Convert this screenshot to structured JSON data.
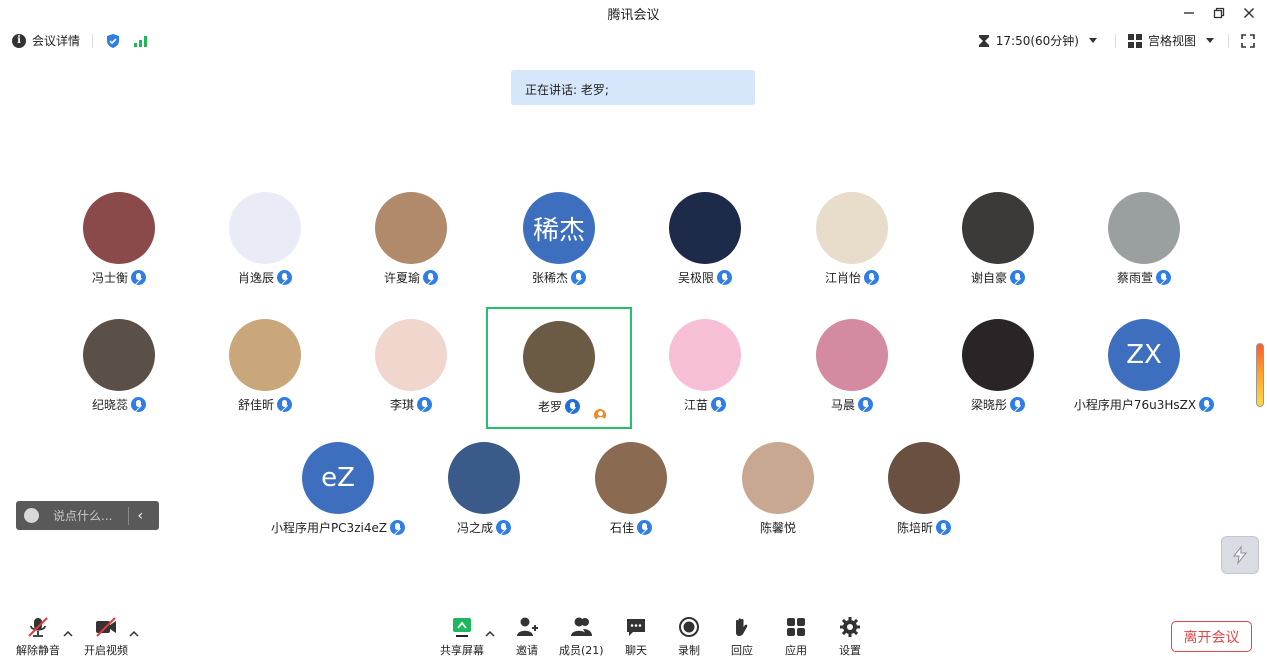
{
  "window": {
    "title": "腾讯会议"
  },
  "infobar": {
    "meeting_details": "会议详情",
    "time": "17:50(60分钟)",
    "view_mode": "宫格视图"
  },
  "banner": {
    "speaking": "正在讲话: 老罗;"
  },
  "participants": [
    {
      "name": "冯士衡",
      "avatar_color": "#8b4a4a",
      "initials": ""
    },
    {
      "name": "肖逸辰",
      "avatar_color": "#e9ecf6",
      "initials": ""
    },
    {
      "name": "许夏瑜",
      "avatar_color": "#b08a6a",
      "initials": ""
    },
    {
      "name": "张稀杰",
      "avatar_color": "#3d6fbe",
      "initials": "稀杰"
    },
    {
      "name": "吴极限",
      "avatar_color": "#1e2a4a",
      "initials": ""
    },
    {
      "name": "江肖怡",
      "avatar_color": "#e8dccb",
      "initials": ""
    },
    {
      "name": "谢自豪",
      "avatar_color": "#3c3a38",
      "initials": ""
    },
    {
      "name": "蔡雨萱",
      "avatar_color": "#9aa0a0",
      "initials": ""
    },
    {
      "name": "纪晓蕊",
      "avatar_color": "#5a5048",
      "initials": ""
    },
    {
      "name": "舒佳昕",
      "avatar_color": "#c9a77a",
      "initials": ""
    },
    {
      "name": "李琪",
      "avatar_color": "#f0d6cc",
      "initials": ""
    },
    {
      "name": "老罗",
      "avatar_color": "#6b5a44",
      "initials": ""
    },
    {
      "name": "江苗",
      "avatar_color": "#f7bfd6",
      "initials": ""
    },
    {
      "name": "马晨",
      "avatar_color": "#d48aa0",
      "initials": ""
    },
    {
      "name": "梁晓彤",
      "avatar_color": "#2a2426",
      "initials": ""
    },
    {
      "name": "小程序用户76u3HsZX",
      "avatar_color": "#3d6fbe",
      "initials": "ZX"
    },
    {
      "name": "小程序用户PC3zi4eZ",
      "avatar_color": "#3d6fbe",
      "initials": "eZ"
    },
    {
      "name": "冯之成",
      "avatar_color": "#3a5a8a",
      "initials": ""
    },
    {
      "name": "石佳",
      "avatar_color": "#8a6a50",
      "initials": ""
    },
    {
      "name": "陈馨悦",
      "avatar_color": "#c8a890",
      "initials": ""
    },
    {
      "name": "陈培昕",
      "avatar_color": "#6a5040",
      "initials": ""
    }
  ],
  "chat": {
    "placeholder": "说点什么..."
  },
  "toolbar": {
    "unmute": "解除静音",
    "start_video": "开启视频",
    "share_screen": "共享屏幕",
    "invite": "邀请",
    "members": "成员(21)",
    "chat": "聊天",
    "record": "录制",
    "reactions": "回应",
    "apps": "应用",
    "settings": "设置",
    "leave": "离开会议"
  },
  "colors": {
    "accent": "#2f7ee8",
    "speaker_highlight": "#23c16b",
    "leave": "#e64545",
    "share_green": "#1eb85c"
  }
}
